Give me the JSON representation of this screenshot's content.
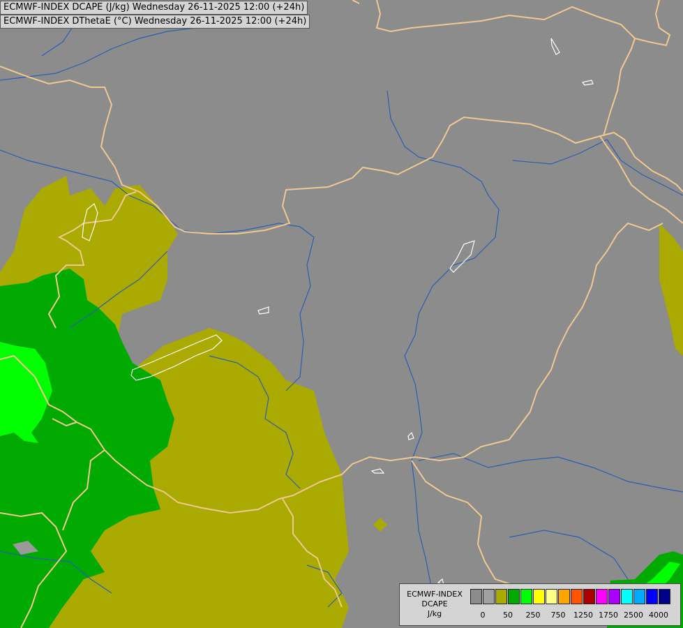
{
  "titles": {
    "line1": "ECMWF-INDEX DCAPE (J/kg) Wednesday 26-11-2025 12:00 (+24h)",
    "line2": "ECMWF-INDEX DThetaE (°C) Wednesday 26-11-2025 12:00 (+24h)"
  },
  "legend": {
    "line1": "ECMWF-INDEX",
    "line2": "DCAPE",
    "line3": "J/kg",
    "colors": [
      "#8c8c8c",
      "#a0a0a0",
      "#aaaa00",
      "#00aa00",
      "#00ff00",
      "#ffff00",
      "#ffff88",
      "#ffa500",
      "#ff5500",
      "#aa0000",
      "#ff00ff",
      "#aa00ff",
      "#00ffff",
      "#00aaff",
      "#0000ff",
      "#000088"
    ],
    "tick_labels": [
      "0",
      "50",
      "250",
      "750",
      "1250",
      "1750",
      "2500",
      "4000"
    ]
  },
  "map_colors": {
    "background": "#8c8c8c",
    "olive": "#aaaa00",
    "green": "#00aa00",
    "bright_green": "#00ff00",
    "borders": "#f0c890",
    "rivers": "#2a5fb0",
    "lakes": "#ffffff"
  }
}
